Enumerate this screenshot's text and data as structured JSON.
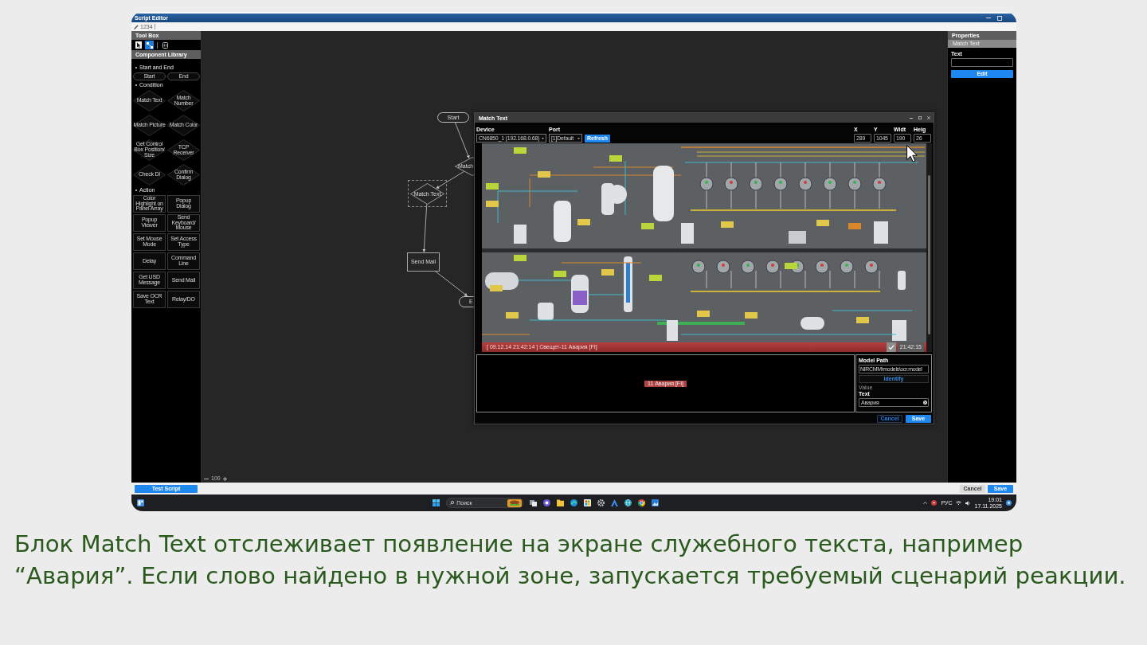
{
  "window": {
    "title": "Script Editor",
    "script_name": "1234"
  },
  "toolbox": {
    "title": "Tool Box",
    "tools": [
      {
        "kind": "pointer",
        "selected": false
      },
      {
        "kind": "connector",
        "selected": true
      },
      {
        "kind": "delete",
        "selected": false
      }
    ]
  },
  "library": {
    "title": "Component Library",
    "sections": [
      {
        "title": "Start and End",
        "kind": "terminal",
        "items": [
          "Start",
          "End"
        ]
      },
      {
        "title": "Condition",
        "kind": "condition",
        "items": [
          "Match Text",
          "Match Number",
          "Match Picture",
          "Match Color",
          "Get Control Box Position/Size",
          "TCP Receiver",
          "Check DI",
          "Confirm Dialog"
        ]
      },
      {
        "title": "Action",
        "kind": "action",
        "items": [
          "Color Highlight on Panel Array",
          "Popup Dialog",
          "Popup Viewer",
          "Send Keyboard/Mouse",
          "Set Mouse Mode",
          "Set Access Type",
          "Delay",
          "Command Line",
          "Get USD Message",
          "Send Mail",
          "Save OCR Text",
          "Relay/DO"
        ]
      }
    ]
  },
  "canvas": {
    "nodes": [
      {
        "kind": "terminal",
        "label": "Start",
        "selected": false
      },
      {
        "kind": "condition",
        "label": "Match",
        "selected": false
      },
      {
        "kind": "condition",
        "label": "Match Text",
        "selected": true
      },
      {
        "kind": "action",
        "label": "Send Mail",
        "selected": false
      },
      {
        "kind": "terminal",
        "label": "E",
        "selected": false
      }
    ],
    "zoom": "100"
  },
  "dialog": {
    "title": "Match Text",
    "device": {
      "label": "Device",
      "value": "CN6850_1 (192.168.0.68)"
    },
    "port": {
      "label": "Port",
      "value": "[1]Default"
    },
    "refresh_button": "Refresh",
    "region": [
      {
        "label": "X",
        "value": "289"
      },
      {
        "label": "Y",
        "value": "1045"
      },
      {
        "label": "Widt",
        "value": "190"
      },
      {
        "label": "Heig",
        "value": "26"
      }
    ],
    "alarm": {
      "text": "[ 09.12.14 21:42:14 ] Свещет-11 Авария [FI]",
      "time": "21:42:15"
    },
    "recognized_text": "11 Авария [FI]",
    "model_path": {
      "label": "Model Path",
      "value": "NIRCMM\\models\\ocr.model"
    },
    "identify_button": "Identify",
    "value_label": "Value",
    "text_field": {
      "label": "Text",
      "value": "Авария"
    },
    "buttons": [
      {
        "label": "Cancel",
        "kind": "secondary"
      },
      {
        "label": "Save",
        "kind": "primary"
      }
    ]
  },
  "properties": {
    "title": "Properties",
    "subtitle": "Match Text",
    "text_label": "Text",
    "edit_button": "Edit"
  },
  "footer": {
    "test_button": "Test Script",
    "buttons": [
      {
        "label": "Cancel",
        "kind": "secondary"
      },
      {
        "label": "Save",
        "kind": "primary"
      }
    ]
  },
  "taskbar": {
    "search_placeholder": "Поиск",
    "apps": [
      {
        "kind": "task-view"
      },
      {
        "kind": "chat"
      },
      {
        "kind": "folder"
      },
      {
        "kind": "wave-browser"
      },
      {
        "kind": "store"
      },
      {
        "kind": "settings"
      },
      {
        "kind": "triangle-app"
      },
      {
        "kind": "globe"
      },
      {
        "kind": "ring-browser"
      },
      {
        "kind": "image-app"
      }
    ],
    "language": "РУС",
    "time": "19:01",
    "date": "17.11.2025"
  },
  "caption": "Блок Match Text отслеживает появление на экране служебного текста, например “Авария”. Если слово найдено в нужной зоне, запускается требуемый сценарий реакции."
}
